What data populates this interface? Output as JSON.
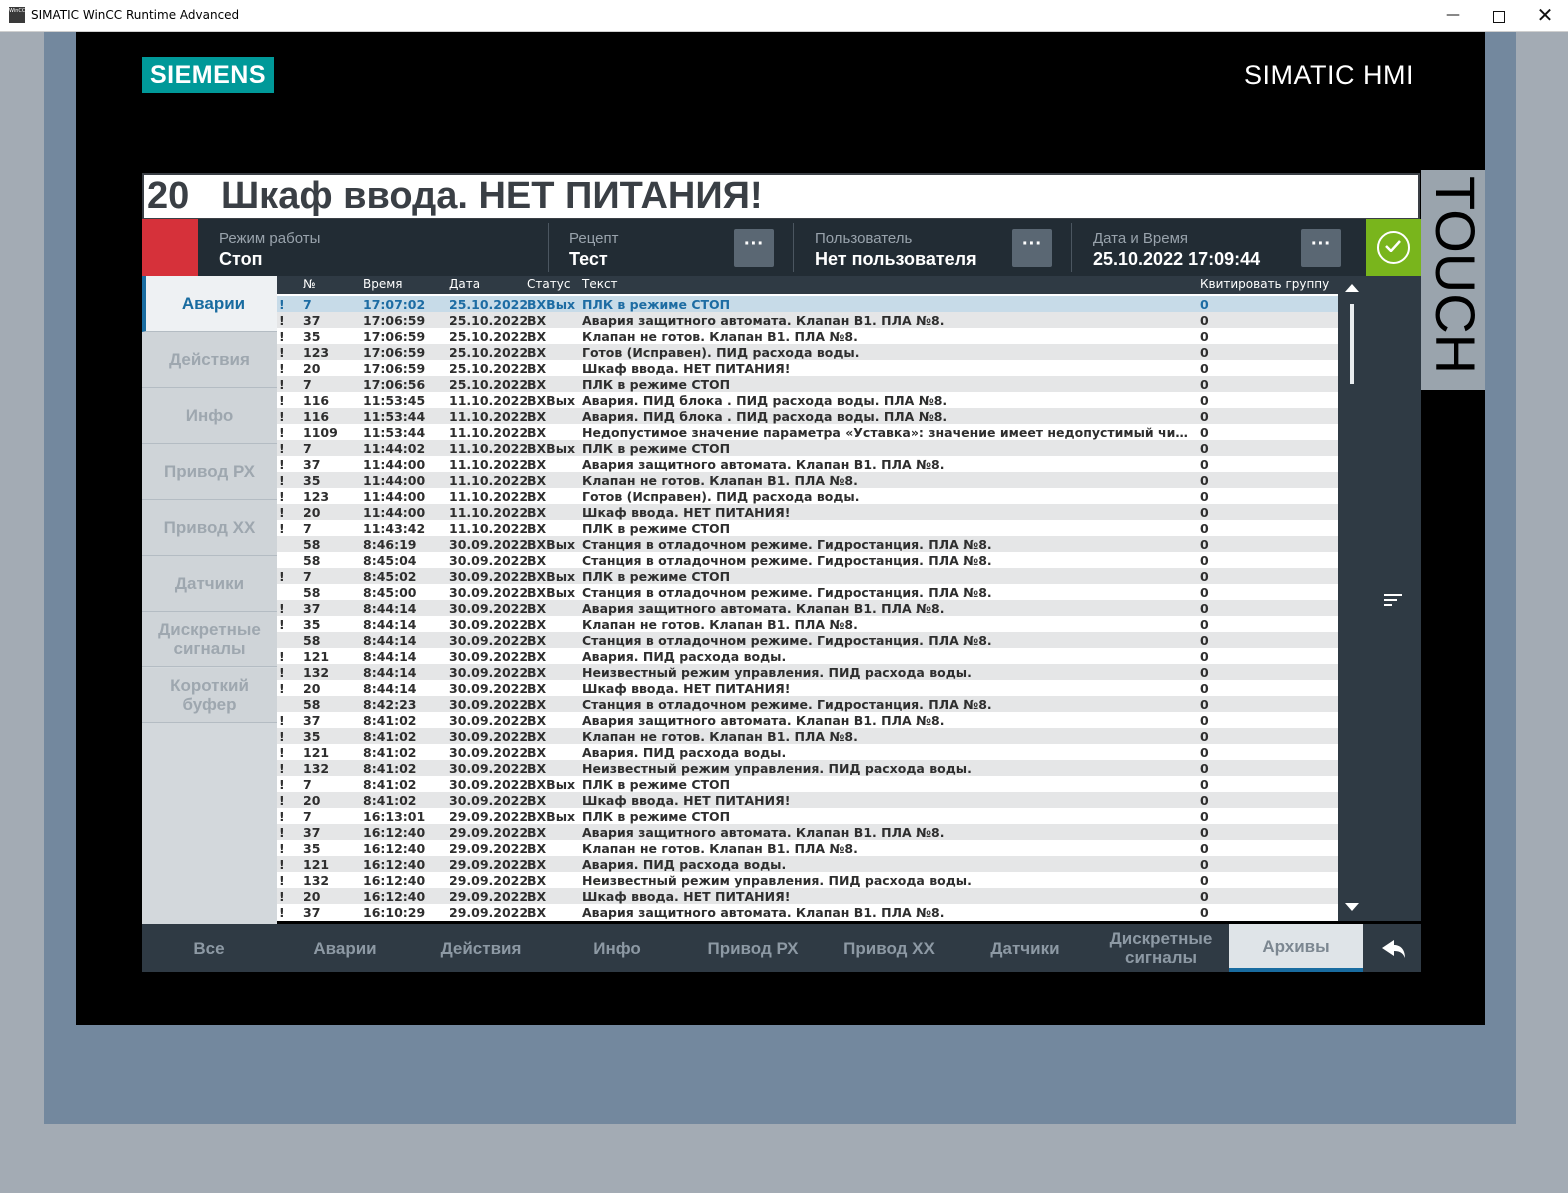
{
  "window": {
    "title": "SIMATIC WinCC Runtime Advanced",
    "icon_text": "WinCC",
    "min_glyph": "—",
    "close_glyph": "✕"
  },
  "brand": {
    "logo": "SIEMENS",
    "product": "SIMATIC HMI",
    "touch": "TOUCH"
  },
  "banner": {
    "number": "20",
    "text": "Шкаф ввода. НЕТ ПИТАНИЯ!"
  },
  "status": {
    "mode_label": "Режим работы",
    "mode_value": "Стоп",
    "recipe_label": "Рецепт",
    "recipe_value": "Тест",
    "user_label": "Пользователь",
    "user_value": "Нет пользователя",
    "datetime_label": "Дата и Время",
    "datetime_value": "25.10.2022 17:09:44",
    "dots": "···"
  },
  "sidebar": {
    "items": [
      {
        "label": "Аварии"
      },
      {
        "label": "Действия"
      },
      {
        "label": "Инфо"
      },
      {
        "label": "Привод РХ"
      },
      {
        "label": "Привод ХХ"
      },
      {
        "label": "Датчики"
      },
      {
        "label": "Дискретные сигналы"
      },
      {
        "label": "Короткий буфер"
      }
    ]
  },
  "table": {
    "headers": {
      "num": "№",
      "time": "Время",
      "date": "Дата",
      "status": "Статус",
      "text": "Текст",
      "ack": "Квитировать группу"
    },
    "rows": [
      {
        "flag": "!",
        "num": "7",
        "time": "17:07:02",
        "date": "25.10.2022",
        "status": "ВХВых",
        "text": "ПЛК в режиме СТОП",
        "ack": "0"
      },
      {
        "flag": "!",
        "num": "37",
        "time": "17:06:59",
        "date": "25.10.2022",
        "status": "ВХ",
        "text": "Авария защитного автомата. Клапан В1. ПЛА №8.",
        "ack": "0"
      },
      {
        "flag": "!",
        "num": "35",
        "time": "17:06:59",
        "date": "25.10.2022",
        "status": "ВХ",
        "text": "Клапан не готов. Клапан В1. ПЛА №8.",
        "ack": "0"
      },
      {
        "flag": "!",
        "num": "123",
        "time": "17:06:59",
        "date": "25.10.2022",
        "status": "ВХ",
        "text": "Готов (Исправен). ПИД расхода воды.",
        "ack": "0"
      },
      {
        "flag": "!",
        "num": "20",
        "time": "17:06:59",
        "date": "25.10.2022",
        "status": "ВХ",
        "text": "Шкаф ввода. НЕТ ПИТАНИЯ!",
        "ack": "0"
      },
      {
        "flag": "!",
        "num": "7",
        "time": "17:06:56",
        "date": "25.10.2022",
        "status": "ВХ",
        "text": "ПЛК в режиме СТОП",
        "ack": "0"
      },
      {
        "flag": "!",
        "num": "116",
        "time": "11:53:45",
        "date": "11.10.2022",
        "status": "ВХВых",
        "text": "Авария. ПИД блока . ПИД расхода воды. ПЛА №8.",
        "ack": "0"
      },
      {
        "flag": "!",
        "num": "116",
        "time": "11:53:44",
        "date": "11.10.2022",
        "status": "ВХ",
        "text": "Авария. ПИД блока . ПИД расхода воды. ПЛА №8.",
        "ack": "0"
      },
      {
        "flag": "!",
        "num": "1109",
        "time": "11:53:44",
        "date": "11.10.2022",
        "status": "ВХ",
        "text": "Недопустимое значение параметра «Уставка»: значение имеет недопустимый числовой формат",
        "ack": "0"
      },
      {
        "flag": "!",
        "num": "7",
        "time": "11:44:02",
        "date": "11.10.2022",
        "status": "ВХВых",
        "text": "ПЛК в режиме СТОП",
        "ack": "0"
      },
      {
        "flag": "!",
        "num": "37",
        "time": "11:44:00",
        "date": "11.10.2022",
        "status": "ВХ",
        "text": "Авария защитного автомата. Клапан В1. ПЛА №8.",
        "ack": "0"
      },
      {
        "flag": "!",
        "num": "35",
        "time": "11:44:00",
        "date": "11.10.2022",
        "status": "ВХ",
        "text": "Клапан не готов. Клапан В1. ПЛА №8.",
        "ack": "0"
      },
      {
        "flag": "!",
        "num": "123",
        "time": "11:44:00",
        "date": "11.10.2022",
        "status": "ВХ",
        "text": "Готов (Исправен). ПИД расхода воды.",
        "ack": "0"
      },
      {
        "flag": "!",
        "num": "20",
        "time": "11:44:00",
        "date": "11.10.2022",
        "status": "ВХ",
        "text": "Шкаф ввода. НЕТ ПИТАНИЯ!",
        "ack": "0"
      },
      {
        "flag": "!",
        "num": "7",
        "time": "11:43:42",
        "date": "11.10.2022",
        "status": "ВХ",
        "text": "ПЛК в режиме СТОП",
        "ack": "0"
      },
      {
        "flag": "",
        "num": "58",
        "time": "8:46:19",
        "date": "30.09.2022",
        "status": "ВХВых",
        "text": "Станция в отладочном режиме. Гидростанция. ПЛА №8.",
        "ack": "0"
      },
      {
        "flag": "",
        "num": "58",
        "time": "8:45:04",
        "date": "30.09.2022",
        "status": "ВХ",
        "text": "Станция в отладочном режиме. Гидростанция. ПЛА №8.",
        "ack": "0"
      },
      {
        "flag": "!",
        "num": "7",
        "time": "8:45:02",
        "date": "30.09.2022",
        "status": "ВХВых",
        "text": "ПЛК в режиме СТОП",
        "ack": "0"
      },
      {
        "flag": "",
        "num": "58",
        "time": "8:45:00",
        "date": "30.09.2022",
        "status": "ВХВых",
        "text": "Станция в отладочном режиме. Гидростанция. ПЛА №8.",
        "ack": "0"
      },
      {
        "flag": "!",
        "num": "37",
        "time": "8:44:14",
        "date": "30.09.2022",
        "status": "ВХ",
        "text": "Авария защитного автомата. Клапан В1. ПЛА №8.",
        "ack": "0"
      },
      {
        "flag": "!",
        "num": "35",
        "time": "8:44:14",
        "date": "30.09.2022",
        "status": "ВХ",
        "text": "Клапан не готов. Клапан В1. ПЛА №8.",
        "ack": "0"
      },
      {
        "flag": "",
        "num": "58",
        "time": "8:44:14",
        "date": "30.09.2022",
        "status": "ВХ",
        "text": "Станция в отладочном режиме. Гидростанция. ПЛА №8.",
        "ack": "0"
      },
      {
        "flag": "!",
        "num": "121",
        "time": "8:44:14",
        "date": "30.09.2022",
        "status": "ВХ",
        "text": "Авария. ПИД расхода воды.",
        "ack": "0"
      },
      {
        "flag": "!",
        "num": "132",
        "time": "8:44:14",
        "date": "30.09.2022",
        "status": "ВХ",
        "text": "Неизвестный режим управления. ПИД расхода воды.",
        "ack": "0"
      },
      {
        "flag": "!",
        "num": "20",
        "time": "8:44:14",
        "date": "30.09.2022",
        "status": "ВХ",
        "text": "Шкаф ввода. НЕТ ПИТАНИЯ!",
        "ack": "0"
      },
      {
        "flag": "",
        "num": "58",
        "time": "8:42:23",
        "date": "30.09.2022",
        "status": "ВХ",
        "text": "Станция в отладочном режиме. Гидростанция. ПЛА №8.",
        "ack": "0"
      },
      {
        "flag": "!",
        "num": "37",
        "time": "8:41:02",
        "date": "30.09.2022",
        "status": "ВХ",
        "text": "Авария защитного автомата. Клапан В1. ПЛА №8.",
        "ack": "0"
      },
      {
        "flag": "!",
        "num": "35",
        "time": "8:41:02",
        "date": "30.09.2022",
        "status": "ВХ",
        "text": "Клапан не готов. Клапан В1. ПЛА №8.",
        "ack": "0"
      },
      {
        "flag": "!",
        "num": "121",
        "time": "8:41:02",
        "date": "30.09.2022",
        "status": "ВХ",
        "text": "Авария. ПИД расхода воды.",
        "ack": "0"
      },
      {
        "flag": "!",
        "num": "132",
        "time": "8:41:02",
        "date": "30.09.2022",
        "status": "ВХ",
        "text": "Неизвестный режим управления. ПИД расхода воды.",
        "ack": "0"
      },
      {
        "flag": "!",
        "num": "7",
        "time": "8:41:02",
        "date": "30.09.2022",
        "status": "ВХВых",
        "text": "ПЛК в режиме СТОП",
        "ack": "0"
      },
      {
        "flag": "!",
        "num": "20",
        "time": "8:41:02",
        "date": "30.09.2022",
        "status": "ВХ",
        "text": "Шкаф ввода. НЕТ ПИТАНИЯ!",
        "ack": "0"
      },
      {
        "flag": "!",
        "num": "7",
        "time": "16:13:01",
        "date": "29.09.2022",
        "status": "ВХВых",
        "text": "ПЛК в режиме СТОП",
        "ack": "0"
      },
      {
        "flag": "!",
        "num": "37",
        "time": "16:12:40",
        "date": "29.09.2022",
        "status": "ВХ",
        "text": "Авария защитного автомата. Клапан В1. ПЛА №8.",
        "ack": "0"
      },
      {
        "flag": "!",
        "num": "35",
        "time": "16:12:40",
        "date": "29.09.2022",
        "status": "ВХ",
        "text": "Клапан не готов. Клапан В1. ПЛА №8.",
        "ack": "0"
      },
      {
        "flag": "!",
        "num": "121",
        "time": "16:12:40",
        "date": "29.09.2022",
        "status": "ВХ",
        "text": "Авария. ПИД расхода воды.",
        "ack": "0"
      },
      {
        "flag": "!",
        "num": "132",
        "time": "16:12:40",
        "date": "29.09.2022",
        "status": "ВХ",
        "text": "Неизвестный режим управления. ПИД расхода воды.",
        "ack": "0"
      },
      {
        "flag": "!",
        "num": "20",
        "time": "16:12:40",
        "date": "29.09.2022",
        "status": "ВХ",
        "text": "Шкаф ввода. НЕТ ПИТАНИЯ!",
        "ack": "0"
      },
      {
        "flag": "!",
        "num": "37",
        "time": "16:10:29",
        "date": "29.09.2022",
        "status": "ВХ",
        "text": "Авария защитного автомата. Клапан В1. ПЛА №8.",
        "ack": "0"
      }
    ]
  },
  "bottom_nav": {
    "items": [
      {
        "label": "Все"
      },
      {
        "label": "Аварии"
      },
      {
        "label": "Действия"
      },
      {
        "label": "Инфо"
      },
      {
        "label": "Привод РХ"
      },
      {
        "label": "Привод ХХ"
      },
      {
        "label": "Датчики"
      },
      {
        "label": "Дискретные сигналы"
      },
      {
        "label": "Архивы"
      }
    ]
  },
  "icons": {
    "acknowledge": "check-circle-icon",
    "sort": "sort-icon",
    "back": "back-arrow-icon",
    "scroll_up": "triangle-up-icon",
    "scroll_down": "triangle-down-icon"
  },
  "colors": {
    "siemens_teal": "#009999",
    "alarm_red": "#d6313a",
    "ack_green": "#79b51c",
    "selection_blue": "#196ca0",
    "dark_panel": "#222c34"
  }
}
